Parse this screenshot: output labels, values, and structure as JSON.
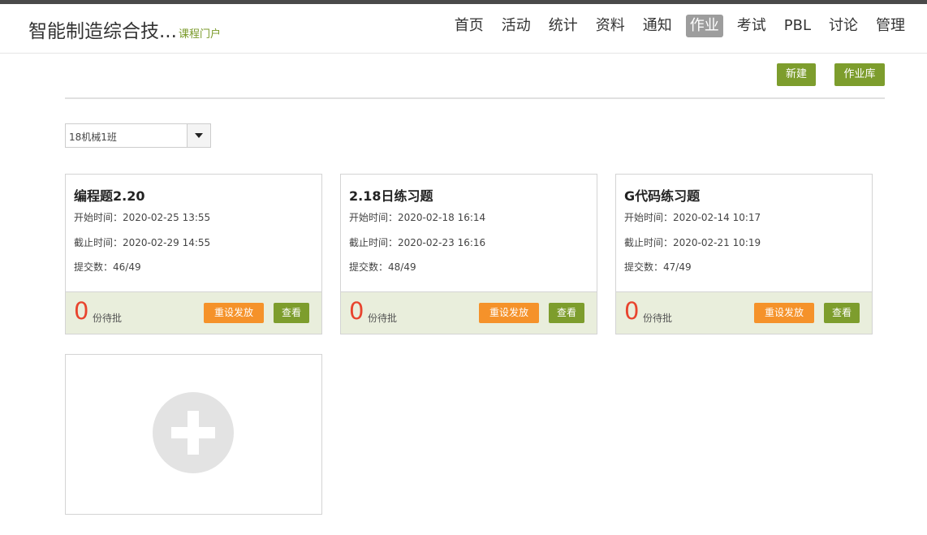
{
  "header": {
    "title": "智能制造综合技...",
    "subtitle": "课程门户"
  },
  "nav": {
    "items": [
      {
        "label": "首页",
        "active": false
      },
      {
        "label": "活动",
        "active": false
      },
      {
        "label": "统计",
        "active": false
      },
      {
        "label": "资料",
        "active": false
      },
      {
        "label": "通知",
        "active": false
      },
      {
        "label": "作业",
        "active": true
      },
      {
        "label": "考试",
        "active": false
      },
      {
        "label": "PBL",
        "active": false
      },
      {
        "label": "讨论",
        "active": false
      },
      {
        "label": "管理",
        "active": false
      }
    ]
  },
  "toolbar": {
    "new_label": "新建",
    "library_label": "作业库"
  },
  "class_select": {
    "value": "18机械1班"
  },
  "assignments": [
    {
      "title": "编程题2.20",
      "start_label": "开始时间：",
      "start": "2020-02-25 13:55",
      "end_label": "截止时间：",
      "end": "2020-02-29 14:55",
      "submit_label": "提交数：",
      "submitted": "46/49",
      "pending_count": "0",
      "pending_label": "份待批",
      "reset_label": "重设发放",
      "view_label": "查看"
    },
    {
      "title": "2.18日练习题",
      "start_label": "开始时间：",
      "start": "2020-02-18 16:14",
      "end_label": "截止时间：",
      "end": "2020-02-23 16:16",
      "submit_label": "提交数：",
      "submitted": "48/49",
      "pending_count": "0",
      "pending_label": "份待批",
      "reset_label": "重设发放",
      "view_label": "查看"
    },
    {
      "title": "G代码练习题",
      "start_label": "开始时间：",
      "start": "2020-02-14 10:17",
      "end_label": "截止时间：",
      "end": "2020-02-21 10:19",
      "submit_label": "提交数：",
      "submitted": "47/49",
      "pending_count": "0",
      "pending_label": "份待批",
      "reset_label": "重设发放",
      "view_label": "查看"
    }
  ],
  "colors": {
    "accent_green": "#7d9d2d",
    "orange": "#f5922a",
    "pending_red": "#e8442e",
    "nav_active": "#9d9d9d"
  }
}
